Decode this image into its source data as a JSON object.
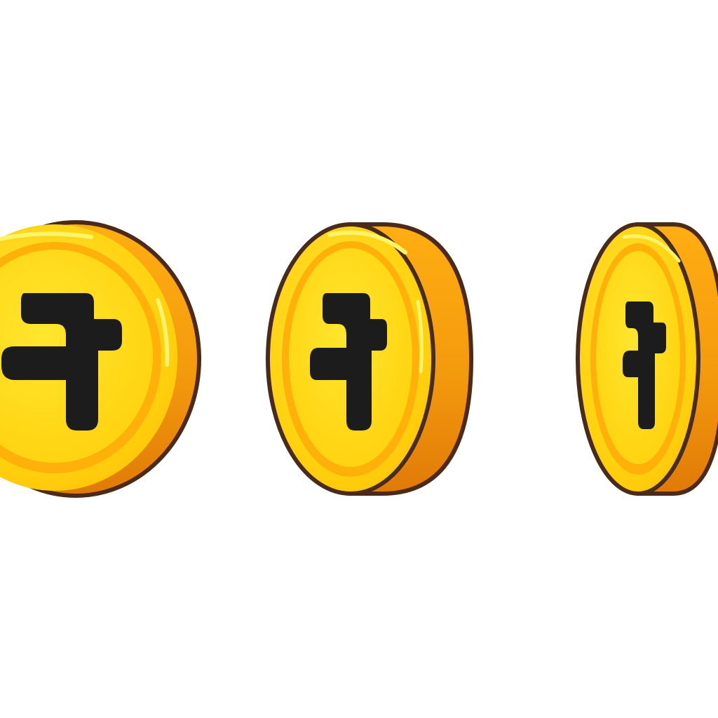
{
  "sprite_sheet": {
    "background": "#ffffff",
    "subject": "coin-spin-animation",
    "frame_count": 3,
    "palette": {
      "outline": "#4a2a18",
      "face_light": "#ffd91a",
      "face_mid": "#ffc107",
      "rim_light": "#ffae12",
      "rim_mid": "#f49a0d",
      "rim_dark": "#e07a07",
      "highlight": "#fff36a",
      "glyph": "#1c1c1c"
    },
    "frames": [
      {
        "name": "coin-frame-1",
        "glyph_icon": "coin-symbol-icon",
        "rotation_state": "front"
      },
      {
        "name": "coin-frame-2",
        "glyph_icon": "coin-symbol-icon",
        "rotation_state": "turning"
      },
      {
        "name": "coin-frame-3",
        "glyph_icon": "coin-symbol-icon",
        "rotation_state": "edge-near"
      }
    ]
  }
}
